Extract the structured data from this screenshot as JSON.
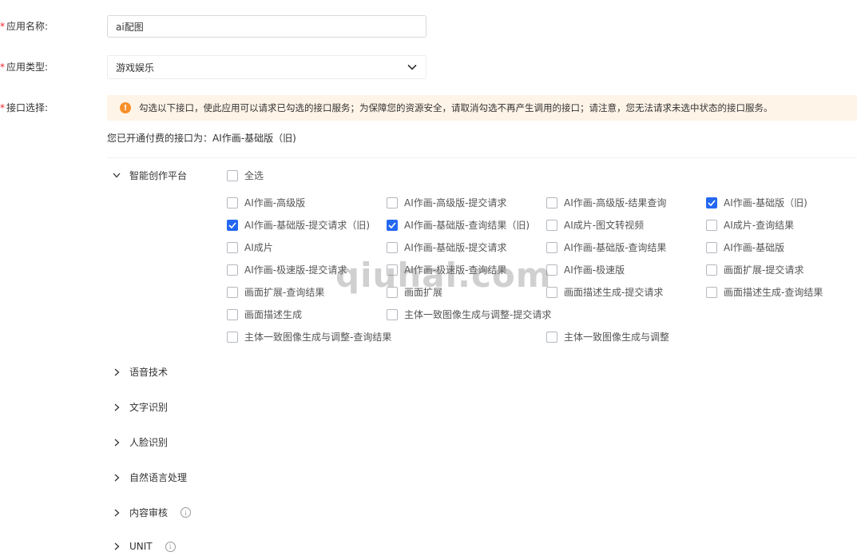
{
  "form": {
    "app_name_label": "应用名称:",
    "app_name_value": "ai配图",
    "app_type_label": "应用类型:",
    "app_type_value": "游戏娱乐",
    "api_select_label": "接口选择:",
    "required_mark": "*"
  },
  "notice": {
    "text": "勾选以下接口，使此应用可以请求已勾选的接口服务；为保障您的资源安全，请取消勾选不再产生调用的接口；请注意，您无法请求未选中状态的接口服务。",
    "icon": "!"
  },
  "paid_text": "您已开通付费的接口为：AI作画-基础版（旧)",
  "groups": {
    "smart_creation": {
      "label": "智能创作平台",
      "select_all": "全选",
      "items": [
        {
          "label": "AI作画-高级版",
          "checked": false
        },
        {
          "label": "AI作画-高级版-提交请求",
          "checked": false
        },
        {
          "label": "AI作画-高级版-结果查询",
          "checked": false
        },
        {
          "label": "AI作画-基础版（旧)",
          "checked": true
        },
        {
          "label": "AI作画-基础版-提交请求（旧)",
          "checked": true
        },
        {
          "label": "AI作画-基础版-查询结果（旧)",
          "checked": true
        },
        {
          "label": "AI成片-图文转视频",
          "checked": false
        },
        {
          "label": "AI成片-查询结果",
          "checked": false
        },
        {
          "label": "AI成片",
          "checked": false
        },
        {
          "label": "AI作画-基础版-提交请求",
          "checked": false
        },
        {
          "label": "AI作画-基础版-查询结果",
          "checked": false
        },
        {
          "label": "AI作画-基础版",
          "checked": false
        },
        {
          "label": "AI作画-极速版-提交请求",
          "checked": false
        },
        {
          "label": "AI作画-极速版-查询结果",
          "checked": false
        },
        {
          "label": "AI作画-极速版",
          "checked": false
        },
        {
          "label": "画面扩展-提交请求",
          "checked": false
        },
        {
          "label": "画面扩展-查询结果",
          "checked": false
        },
        {
          "label": "画面扩展",
          "checked": false
        },
        {
          "label": "画面描述生成-提交请求",
          "checked": false
        },
        {
          "label": "画面描述生成-查询结果",
          "checked": false
        },
        {
          "label": "画面描述生成",
          "checked": false
        },
        {
          "label": "主体一致图像生成与调整-提交请求",
          "checked": false
        },
        {
          "label": "主体一致图像生成与调整-查询结果",
          "checked": false
        },
        {
          "label": "主体一致图像生成与调整",
          "checked": false
        }
      ]
    },
    "speech": {
      "label": "语音技术"
    },
    "ocr": {
      "label": "文字识别"
    },
    "face": {
      "label": "人脸识别"
    },
    "nlp": {
      "label": "自然语言处理"
    },
    "audit": {
      "label": "内容审核"
    },
    "unit": {
      "label": "UNIT"
    }
  },
  "watermark": "qiuhai.com",
  "colors": {
    "checkbox_checked": "#2468f2",
    "notice_bg": "#fff4e8",
    "warn_icon": "#f7902a",
    "required": "#f5222d"
  }
}
